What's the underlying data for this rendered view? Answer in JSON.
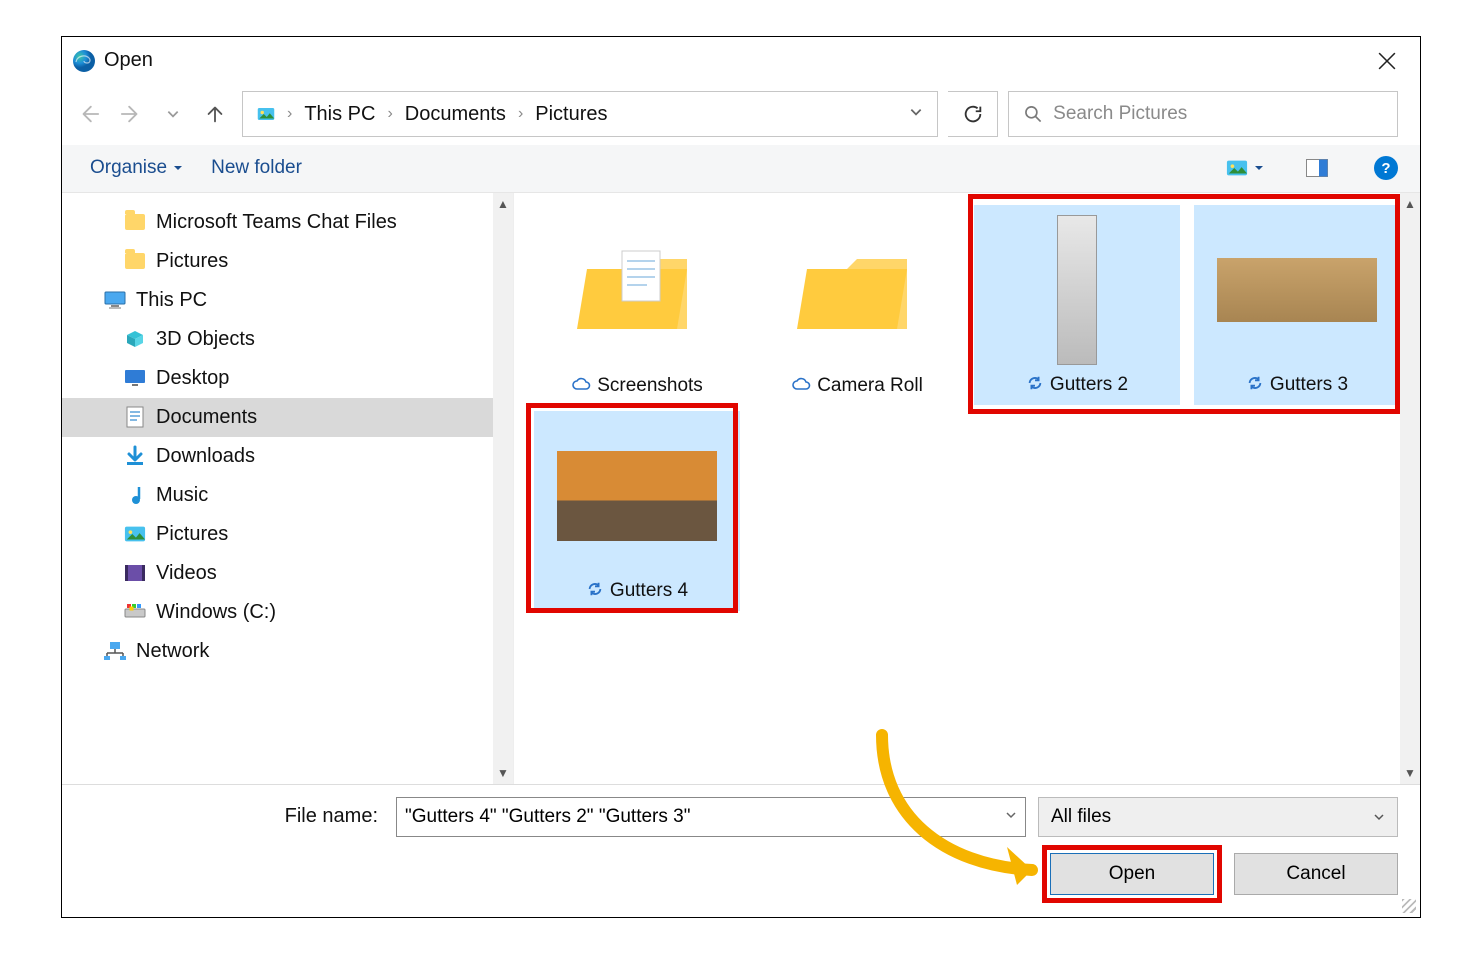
{
  "title": "Open",
  "breadcrumb": [
    "This PC",
    "Documents",
    "Pictures"
  ],
  "search": {
    "placeholder": "Search Pictures"
  },
  "toolbar": {
    "organise": "Organise",
    "new_folder": "New folder"
  },
  "sidebar": {
    "items": [
      {
        "label": "Microsoft Teams Chat Files",
        "icon": "folder",
        "level": 1
      },
      {
        "label": "Pictures",
        "icon": "folder",
        "level": 1
      },
      {
        "label": "This PC",
        "icon": "pc",
        "level": 0
      },
      {
        "label": "3D Objects",
        "icon": "cube",
        "level": 1
      },
      {
        "label": "Desktop",
        "icon": "desktop",
        "level": 1
      },
      {
        "label": "Documents",
        "icon": "document",
        "level": 1,
        "selected": true
      },
      {
        "label": "Downloads",
        "icon": "download",
        "level": 1
      },
      {
        "label": "Music",
        "icon": "music",
        "level": 1
      },
      {
        "label": "Pictures",
        "icon": "pictures",
        "level": 1
      },
      {
        "label": "Videos",
        "icon": "videos",
        "level": 1
      },
      {
        "label": "Windows (C:)",
        "icon": "drive",
        "level": 1
      },
      {
        "label": "Network",
        "icon": "network",
        "level": 0
      }
    ]
  },
  "files": {
    "row1": [
      {
        "name": "Screenshots",
        "type": "folder",
        "badge": "cloud"
      },
      {
        "name": "Camera Roll",
        "type": "folder",
        "badge": "cloud"
      },
      {
        "name": "Gutters 2",
        "type": "image",
        "badge": "sync",
        "selected": true,
        "thumb": "g2"
      },
      {
        "name": "Gutters 3",
        "type": "image",
        "badge": "sync",
        "selected": true,
        "thumb": "g3"
      }
    ],
    "row2": [
      {
        "name": "Gutters 4",
        "type": "image",
        "badge": "sync",
        "selected": true,
        "thumb": "g4"
      }
    ]
  },
  "filename": {
    "label": "File name:",
    "value": "\"Gutters 4\" \"Gutters 2\" \"Gutters 3\""
  },
  "filetype": {
    "value": "All files"
  },
  "buttons": {
    "open": "Open",
    "cancel": "Cancel"
  }
}
